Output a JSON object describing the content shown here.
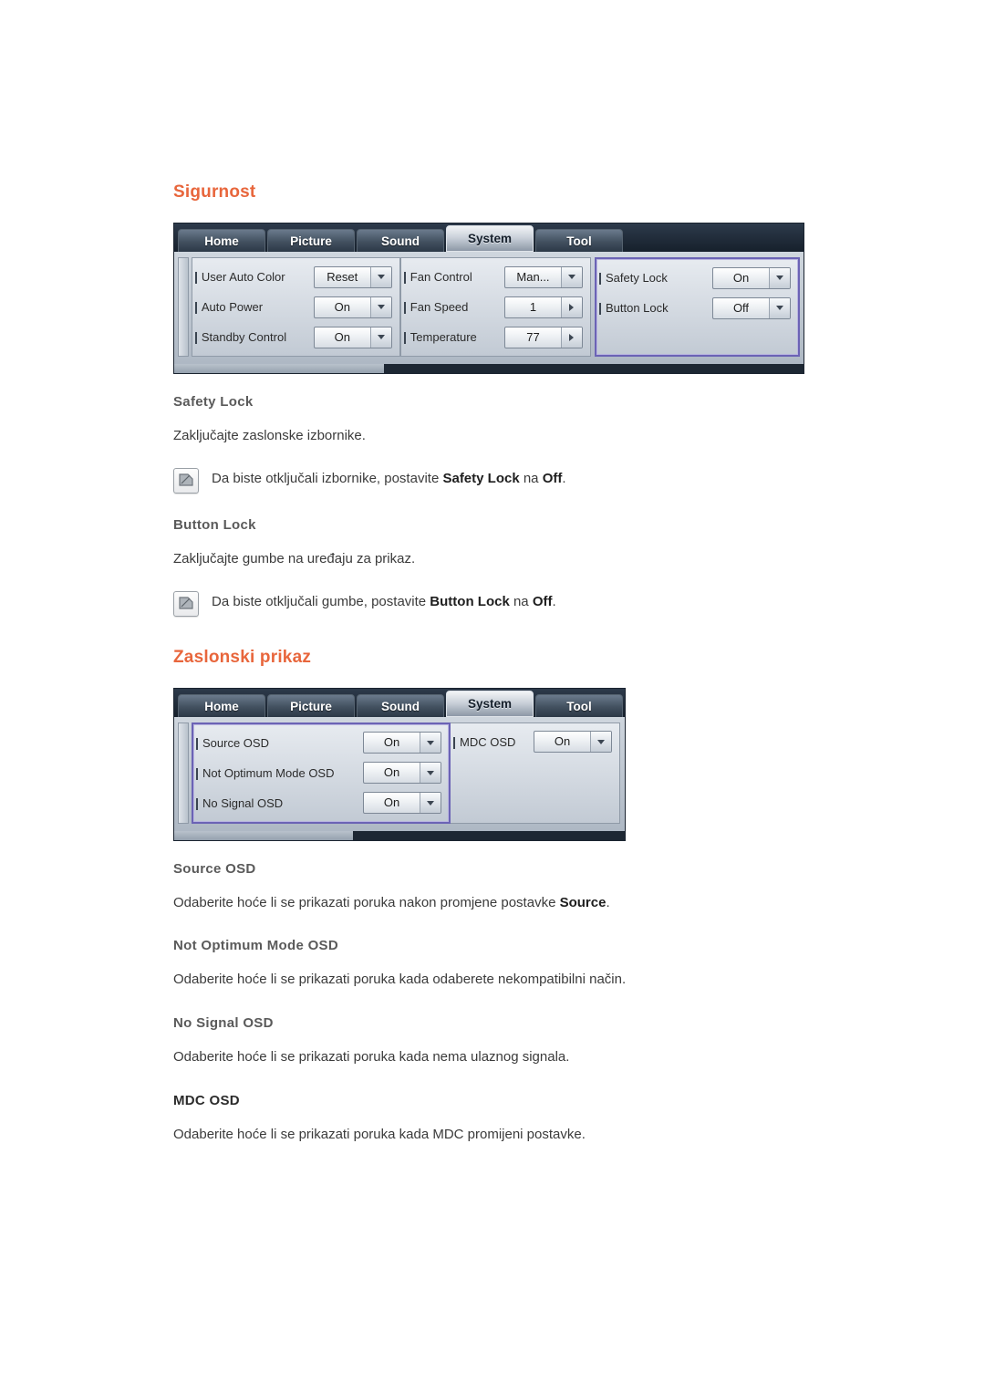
{
  "sections": [
    {
      "title": "Sigurnost",
      "osd": {
        "tabs": [
          {
            "label": "Home",
            "active": false
          },
          {
            "label": "Picture",
            "active": false
          },
          {
            "label": "Sound",
            "active": false
          },
          {
            "label": "System",
            "active": true
          },
          {
            "label": "Tool",
            "active": false
          }
        ],
        "columns": [
          {
            "highlight": false,
            "rows": [
              {
                "label": "User Auto Color",
                "value": "Reset",
                "control": "dropdown"
              },
              {
                "label": "Auto Power",
                "value": "On",
                "control": "dropdown"
              },
              {
                "label": "Standby Control",
                "value": "On",
                "control": "dropdown"
              }
            ]
          },
          {
            "highlight": false,
            "rows": [
              {
                "label": "Fan Control",
                "value": "Man...",
                "control": "dropdown"
              },
              {
                "label": "Fan Speed",
                "value": "1",
                "control": "spinner"
              },
              {
                "label": "Temperature",
                "value": "77",
                "control": "spinner"
              }
            ]
          },
          {
            "highlight": true,
            "rows": [
              {
                "label": "Safety Lock",
                "value": "On",
                "control": "dropdown"
              },
              {
                "label": "Button Lock",
                "value": "Off",
                "control": "dropdown"
              }
            ]
          }
        ]
      },
      "entries": [
        {
          "heading": "Safety Lock",
          "heading_style": "gray",
          "text": "Zaključajte zaslonske izbornike.",
          "note": {
            "prefix": "Da biste otključali izbornike, postavite ",
            "bold1": "Safety Lock",
            "middle": " na ",
            "bold2": "Off",
            "suffix": "."
          }
        },
        {
          "heading": "Button Lock",
          "heading_style": "gray",
          "text": "Zaključajte gumbe na uređaju za prikaz.",
          "note": {
            "prefix": "Da biste otključali gumbe, postavite ",
            "bold1": "Button Lock",
            "middle": " na ",
            "bold2": "Off",
            "suffix": "."
          }
        }
      ]
    },
    {
      "title": "Zaslonski prikaz",
      "osd": {
        "tabs": [
          {
            "label": "Home",
            "active": false
          },
          {
            "label": "Picture",
            "active": false
          },
          {
            "label": "Sound",
            "active": false
          },
          {
            "label": "System",
            "active": true
          },
          {
            "label": "Tool",
            "active": false
          }
        ],
        "columns": [
          {
            "highlight": false,
            "rows": [
              {
                "label": "Source OSD",
                "value": "On",
                "control": "dropdown"
              },
              {
                "label": "Not Optimum Mode OSD",
                "value": "On",
                "control": "dropdown"
              },
              {
                "label": "No Signal OSD",
                "value": "On",
                "control": "dropdown"
              }
            ]
          },
          {
            "highlight": false,
            "rows": [
              {
                "label": "MDC OSD",
                "value": "On",
                "control": "dropdown"
              }
            ]
          }
        ]
      },
      "entries": [
        {
          "heading": "Source OSD",
          "heading_style": "gray",
          "text_prefix": "Odaberite hoće li se prikazati poruka nakon promjene postavke ",
          "text_bold": "Source",
          "text_suffix": "."
        },
        {
          "heading": "Not Optimum Mode OSD",
          "heading_style": "gray",
          "text": "Odaberite hoće li se prikazati poruka kada odaberete nekompatibilni način."
        },
        {
          "heading": "No Signal OSD",
          "heading_style": "gray",
          "text": "Odaberite hoće li se prikazati poruka kada nema ulaznog signala."
        },
        {
          "heading": "MDC OSD",
          "heading_style": "dark",
          "text": "Odaberite hoće li se prikazati poruka kada MDC promijeni postavke."
        }
      ]
    }
  ],
  "colors": {
    "heading_orange": "#e8663c",
    "subheading_gray": "#5a5a5a",
    "body_text": "#3b3b3b",
    "osd_dark": "#1d2733",
    "osd_highlight_border": "#6b63b5"
  }
}
